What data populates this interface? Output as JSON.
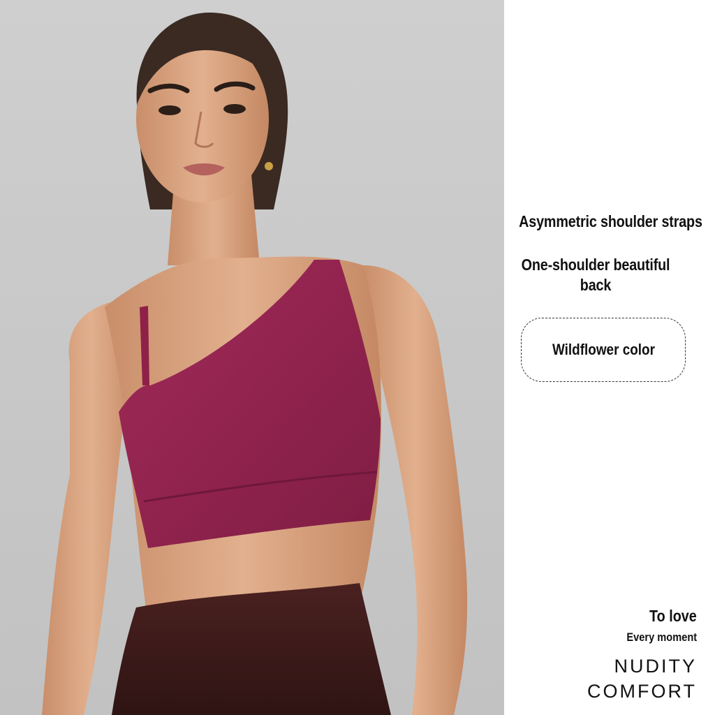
{
  "features": {
    "straps": "Asymmetric shoulder straps",
    "back": "One-shoulder beautiful back",
    "color": "Wildflower color"
  },
  "tagline": {
    "line1": "To love",
    "line2": "Every moment",
    "line3": "NUDITY",
    "line4": "COMFORT"
  },
  "colors": {
    "background": "#c8c8c8",
    "skin": "#d9a583",
    "top": "#95244f",
    "leggings": "#3b1a1a",
    "hair": "#3a2a22"
  }
}
